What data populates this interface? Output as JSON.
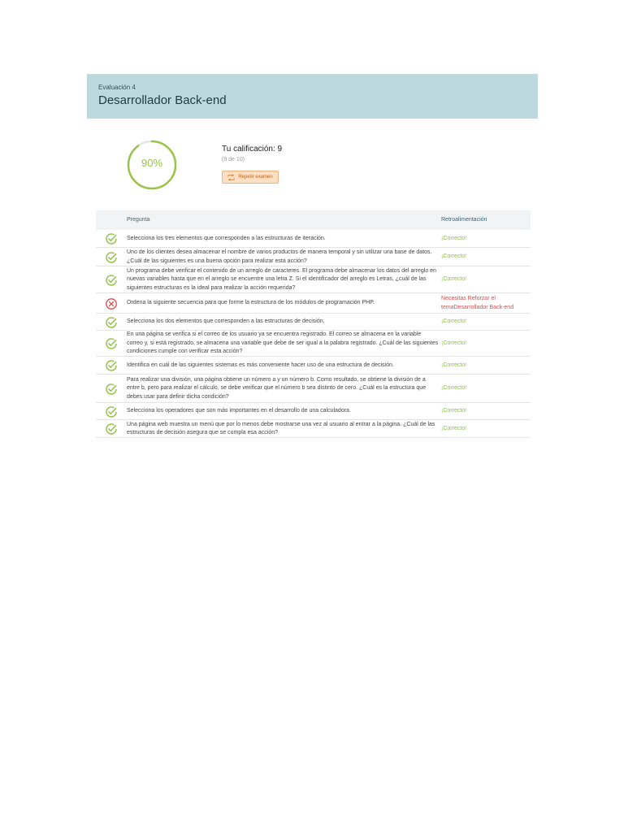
{
  "header": {
    "kicker": "Evaluación 4",
    "title": "Desarrollador Back-end"
  },
  "score": {
    "percent_label": "90%",
    "percent_value": 90,
    "grade_label": "Tu calificación: 9",
    "grade_sub": "(9 de 10)",
    "retry_label": "Repetir examen"
  },
  "colors": {
    "correct": "#8fbf3f",
    "incorrect": "#e04a4a",
    "header_bg": "#bcd9df",
    "retry_bg": "#fde0c4"
  },
  "table": {
    "col_question": "Pregunta",
    "col_feedback": "Retroalimentación",
    "rows": [
      {
        "status": "correct",
        "question": "Selecciona los tres elementos que corresponden a las estructuras de iteración.",
        "feedback": "¡Correcto!"
      },
      {
        "status": "correct",
        "question": "Uno de los clientes desea almacenar el nombre de varios productos de manera temporal y sin utilizar una base de datos. ¿Cuál de las siguientes es una buena opción para realizar esta acción?",
        "feedback": "¡Correcto!"
      },
      {
        "status": "correct",
        "question": "Un programa debe verificar el contenido de un arreglo de caracteres. El programa debe almacenar los datos del arreglo en nuevas variables hasta que en el arreglo se encuentre una letra Z. Si el identificador del arreglo es Letras, ¿cuál de las siguientes estructuras es la ideal para realizar la acción requerida?",
        "feedback": "¡Correcto!"
      },
      {
        "status": "incorrect",
        "question": "Ordena la siguiente secuencia para que forme la estructura de los módulos de programación PHP.",
        "feedback": "Necesitas Reforzar el temaDesarrollador Back-end"
      },
      {
        "status": "correct",
        "question": "Selecciona los dos elementos que corresponden a las estructuras de decisión.",
        "feedback": "¡Correcto!"
      },
      {
        "status": "correct",
        "question": "En una página se verifica si el correo de los usuario ya se encuentra registrado. El correo se almacena en la variable correo y, si está registrado, se almacena una variable que debe de ser igual a la palabra registrado. ¿Cuál de las siguientes condiciones cumple con verificar esta acción?",
        "feedback": "¡Correcto!"
      },
      {
        "status": "correct",
        "question": "Identifica en cuál de las siguientes sistemas es más conveniente hacer uso de una estructura de decisión.",
        "feedback": "¡Correcto!"
      },
      {
        "status": "correct",
        "question": "Para realizar una división, una página obtiene un número a y un número b. Como resultado, se obtiene la división de a entre b, pero para realizar el cálculo, se debe verificar que el número b sea distinto de cero. ¿Cuál es la estructura que debes usar para definir dicha condición?",
        "feedback": "¡Correcto!"
      },
      {
        "status": "correct",
        "question": "Selecciona los operadores que son más importantes en el desarrollo de una calculadora.",
        "feedback": "¡Correcto!"
      },
      {
        "status": "correct",
        "question": "Una página web muestra un menú que por lo menos debe mostrarse una vez al usuario al entrar a la página. ¿Cuál de las estructuras de decisión asegura que se cumpla esa acción?",
        "feedback": "¡Correcto!"
      }
    ]
  }
}
